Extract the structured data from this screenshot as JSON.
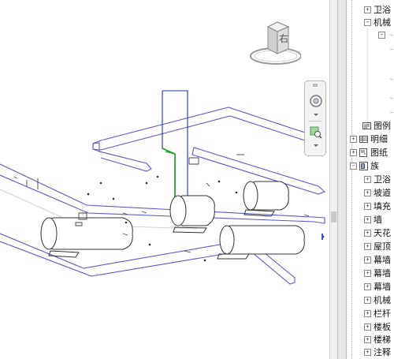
{
  "view_cube": {
    "face_label": "右"
  },
  "navigation_bar": {
    "tools": [
      {
        "name": "steering-wheel-icon"
      },
      {
        "name": "zoom-region-icon"
      }
    ]
  },
  "project_browser": {
    "items": [
      {
        "label": "卫浴",
        "toggle": "+"
      },
      {
        "label": "机械",
        "toggle": "−"
      },
      {
        "label": "图例"
      },
      {
        "label": "明细",
        "toggle": "+"
      },
      {
        "label": "图纸",
        "toggle": "+"
      },
      {
        "label": "族",
        "toggle": "−"
      },
      {
        "label": "卫浴",
        "toggle": "+"
      },
      {
        "label": "坡道",
        "toggle": "+"
      },
      {
        "label": "填充",
        "toggle": "+"
      },
      {
        "label": "墙",
        "toggle": "+"
      },
      {
        "label": "天花",
        "toggle": "+"
      },
      {
        "label": "屋顶",
        "toggle": "+"
      },
      {
        "label": "幕墙",
        "toggle": "+"
      },
      {
        "label": "幕墙",
        "toggle": "+"
      },
      {
        "label": "幕墙",
        "toggle": "+"
      },
      {
        "label": "机械",
        "toggle": "+"
      },
      {
        "label": "栏杆",
        "toggle": "+"
      },
      {
        "label": "楼板",
        "toggle": "+"
      },
      {
        "label": "楼梯",
        "toggle": "+"
      },
      {
        "label": "注释",
        "toggle": "+"
      }
    ]
  }
}
